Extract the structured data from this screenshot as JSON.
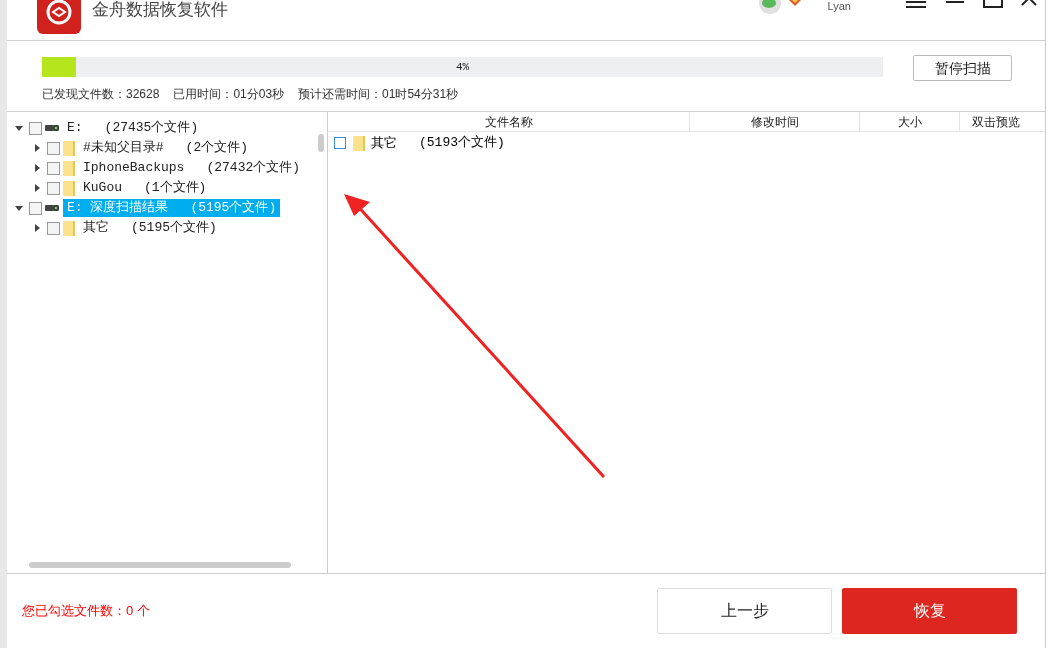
{
  "window": {
    "title": "金舟数据恢复软件",
    "user": "Lyan"
  },
  "scan": {
    "level": 0.04,
    "percent": "4%",
    "pause_button": "暂停扫描",
    "stats": [
      "已发现文件数：32628",
      "已用时间：01分03秒",
      "预计还需时间：01时54分31秒"
    ]
  },
  "tree": [
    {
      "kind": "drive",
      "label": "E:",
      "count": "(27435个文件)",
      "expanded": true,
      "checked": false,
      "selected": false,
      "children": [
        {
          "kind": "folder",
          "label": "#未知父目录#",
          "count": "(2个文件)",
          "expanded": false,
          "checked": false,
          "selected": false
        },
        {
          "kind": "folder",
          "label": "IphoneBackups",
          "count": "(27432个文件)",
          "expanded": false,
          "checked": false,
          "selected": false
        },
        {
          "kind": "folder",
          "label": "KuGou",
          "count": "(1个文件)",
          "expanded": false,
          "checked": false,
          "selected": false
        }
      ]
    },
    {
      "kind": "drive",
      "label": "E: 深度扫描结果",
      "count": "(5195个文件)",
      "expanded": true,
      "checked": false,
      "selected": true,
      "children": [
        {
          "kind": "folder",
          "label": "其它",
          "count": "(5195个文件)",
          "expanded": false,
          "checked": false,
          "selected": false
        }
      ]
    }
  ],
  "table": {
    "columns": [
      "文件名称",
      "修改时间",
      "大小",
      "双击预览"
    ],
    "rows": [
      {
        "name": "其它",
        "count": "(5193个文件)",
        "checked": false
      }
    ]
  },
  "status": "您已勾选文件数：0 个",
  "buttons": {
    "back": "上一步",
    "recover": "恢复"
  }
}
